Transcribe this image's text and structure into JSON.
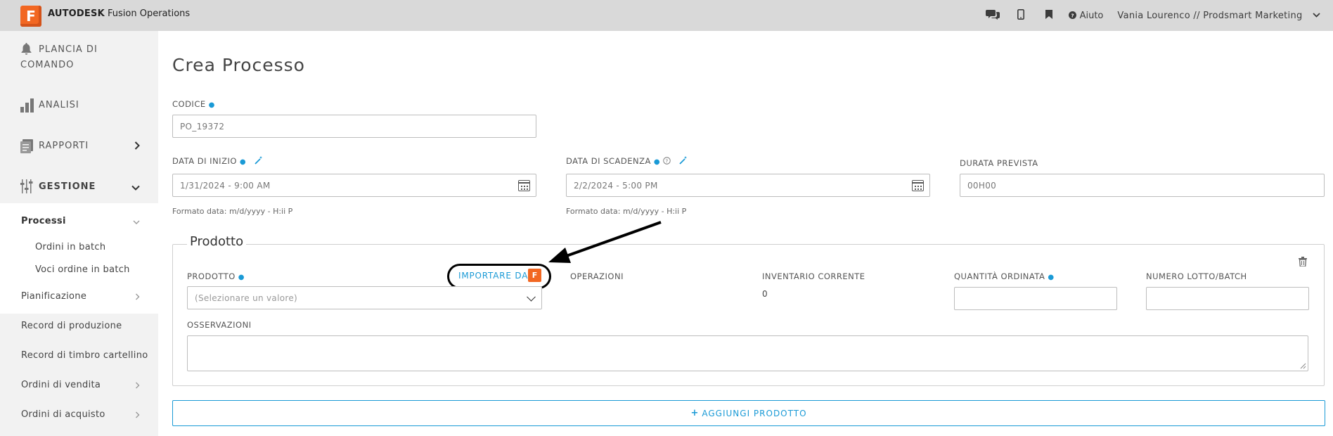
{
  "header": {
    "brand_bold": "AUTODESK",
    "brand_rest": "Fusion Operations",
    "logo_letter": "F",
    "help_label": "Aiuto",
    "user_label": "Vania Lourenco // Prodsmart Marketing",
    "icons": [
      "chat-icon",
      "mobile-icon",
      "bookmark-icon",
      "help-icon",
      "chevron-down-icon"
    ]
  },
  "sidebar": {
    "dashboard": "PLANCIA DI\nCOMANDO",
    "dashboard_l1": "PLANCIA DI",
    "dashboard_l2": "COMANDO",
    "analytics": "ANALISI",
    "reports": "RAPPORTI",
    "management": "GESTIONE",
    "processes": "Processi",
    "batch_orders": "Ordini in batch",
    "batch_items": "Voci ordine in batch",
    "planning": "Pianificazione",
    "production_records": "Record di produzione",
    "timeclock_records": "Record di timbro cartellino",
    "sales_orders": "Ordini di vendita",
    "purchase_orders": "Ordini di acquisto"
  },
  "main": {
    "title": "Crea Processo",
    "code_label": "CODICE",
    "code_value": "PO_19372",
    "start_label": "DATA DI INIZIO",
    "start_value": "1/31/2024 - 9:00 AM",
    "start_hint": "Formato data: m/d/yyyy - H:ii P",
    "due_label": "DATA DI SCADENZA",
    "due_value": "2/2/2024 - 5:00 PM",
    "due_hint": "Formato data: m/d/yyyy - H:ii P",
    "duration_label": "DURATA PREVISTA",
    "duration_value": "00H00"
  },
  "product": {
    "legend": "Prodotto",
    "product_label": "PRODOTTO",
    "import_label": "IMPORTARE DA",
    "select_placeholder": "(Selezionare un valore)",
    "operations_label": "OPERAZIONI",
    "inventory_label": "INVENTARIO CORRENTE",
    "inventory_value": "0",
    "quantity_label": "QUANTITÀ ORDINATA",
    "lot_label": "NUMERO LOTTO/BATCH",
    "notes_label": "OSSERVAZIONI",
    "add_button": "AGGIUNGI PRODOTTO"
  },
  "colors": {
    "accent": "#1a9ad6",
    "brand": "#f26722",
    "topbar": "#d9d9d9",
    "sidebar": "#f2f2f2"
  }
}
